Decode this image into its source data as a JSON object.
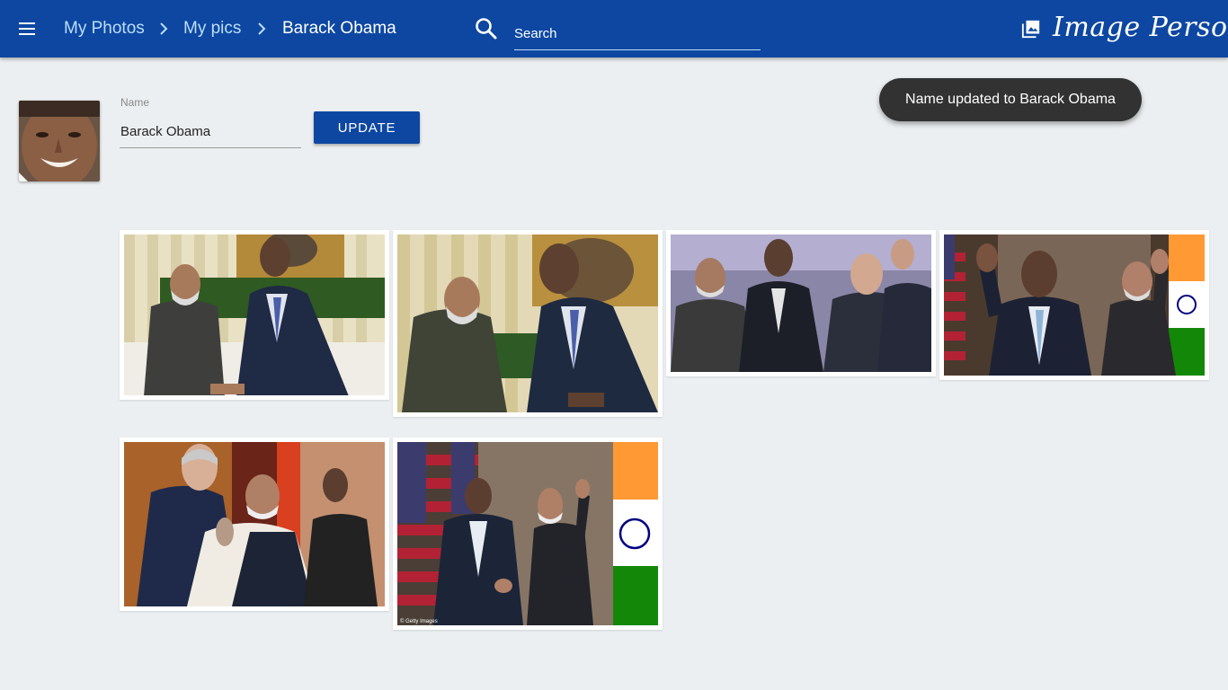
{
  "header": {
    "breadcrumbs": [
      "My Photos",
      "My pics",
      "Barack Obama"
    ],
    "menu_icon": "menu-icon",
    "chevron_icon": "chevron-right-icon",
    "search": {
      "placeholder": "Search",
      "value": "",
      "icon": "search-icon"
    },
    "brand": {
      "name": "Image Persona",
      "icon": "photo-library-icon"
    },
    "colors": {
      "bar": "#0d47a1",
      "link": "#bbdefb"
    }
  },
  "person": {
    "name_label": "Name",
    "name_value": "Barack Obama",
    "update_label": "UPDATE"
  },
  "toast": {
    "message": "Name updated to Barack Obama"
  },
  "photos": [
    {
      "caption": ""
    },
    {
      "caption": ""
    },
    {
      "caption": ""
    },
    {
      "caption": ""
    },
    {
      "caption": ""
    },
    {
      "caption": "© Getty Images"
    }
  ]
}
